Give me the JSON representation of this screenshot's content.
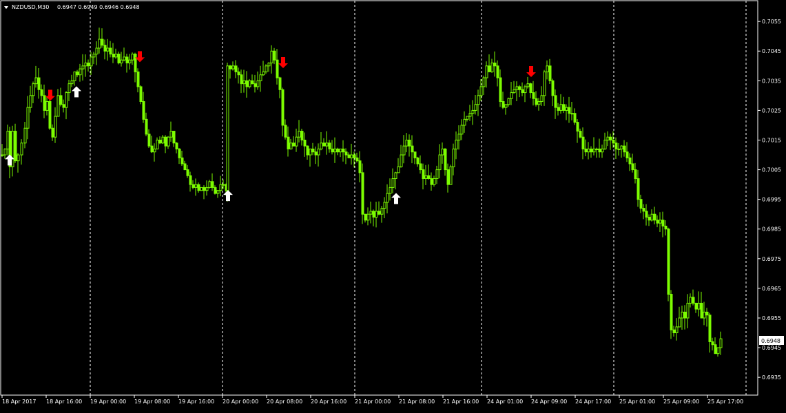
{
  "header": {
    "title": "NZDUSD,M30",
    "ohlc": "0.6947 0.6949 0.6946 0.6948",
    "menu_icon": "triangle-down-icon"
  },
  "colors": {
    "background": "#000000",
    "candle": "#7CFC00",
    "grid": "#ffffff",
    "text": "#ffffff",
    "arrow_down": "#ff0000",
    "arrow_up": "#ffffff",
    "price_label_bg": "#ffffff",
    "price_label_text": "#000000"
  },
  "chart_data": {
    "type": "candlestick",
    "symbol": "NZDUSD",
    "timeframe": "M30",
    "current_price": "0.6948",
    "ylim": [
      0.6929,
      0.7062
    ],
    "y_ticks": [
      "0.7055",
      "0.7045",
      "0.7035",
      "0.7025",
      "0.7015",
      "0.7005",
      "0.6995",
      "0.6985",
      "0.6975",
      "0.6965",
      "0.6955",
      "0.6945",
      "0.6935"
    ],
    "x_ticks": [
      "18 Apr 2017",
      "18 Apr 16:00",
      "19 Apr 00:00",
      "19 Apr 08:00",
      "19 Apr 16:00",
      "20 Apr 00:00",
      "20 Apr 08:00",
      "20 Apr 16:00",
      "21 Apr 00:00",
      "21 Apr 08:00",
      "21 Apr 16:00",
      "24 Apr 01:00",
      "24 Apr 09:00",
      "24 Apr 17:00",
      "25 Apr 01:00",
      "25 Apr 09:00",
      "25 Apr 17:00"
    ],
    "day_separators": [
      "19 Apr 00:00",
      "20 Apr 00:00",
      "21 Apr 00:00",
      "24 Apr 01:00",
      "25 Apr 01:00",
      "26 Apr"
    ],
    "close_path": [
      [
        0,
        0.701
      ],
      [
        4,
        0.7012
      ],
      [
        8,
        0.7018
      ],
      [
        11,
        0.7006
      ],
      [
        15,
        0.7018
      ],
      [
        19,
        0.7008
      ],
      [
        23,
        0.701
      ],
      [
        28,
        0.7014
      ],
      [
        33,
        0.7019
      ],
      [
        37,
        0.7026
      ],
      [
        41,
        0.703
      ],
      [
        45,
        0.7034
      ],
      [
        49,
        0.7036
      ],
      [
        53,
        0.7032
      ],
      [
        57,
        0.703
      ],
      [
        61,
        0.7025
      ],
      [
        65,
        0.7028
      ],
      [
        69,
        0.7019
      ],
      [
        73,
        0.7016
      ],
      [
        77,
        0.7023
      ],
      [
        81,
        0.703
      ],
      [
        85,
        0.7027
      ],
      [
        89,
        0.7026
      ],
      [
        93,
        0.7031
      ],
      [
        97,
        0.7034
      ],
      [
        101,
        0.7035
      ],
      [
        105,
        0.7038
      ],
      [
        109,
        0.7037
      ],
      [
        113,
        0.7039
      ],
      [
        117,
        0.704
      ],
      [
        121,
        0.7041
      ],
      [
        125,
        0.704
      ],
      [
        129,
        0.7043
      ],
      [
        133,
        0.7044
      ],
      [
        137,
        0.7046
      ],
      [
        141,
        0.7049
      ],
      [
        145,
        0.7047
      ],
      [
        149,
        0.7045
      ],
      [
        153,
        0.7046
      ],
      [
        157,
        0.7044
      ],
      [
        161,
        0.7043
      ],
      [
        165,
        0.7044
      ],
      [
        169,
        0.7041
      ],
      [
        173,
        0.7042
      ],
      [
        177,
        0.7043
      ],
      [
        181,
        0.7041
      ],
      [
        185,
        0.7042
      ],
      [
        189,
        0.7044
      ],
      [
        193,
        0.7038
      ],
      [
        197,
        0.7033
      ],
      [
        201,
        0.7028
      ],
      [
        205,
        0.7022
      ],
      [
        209,
        0.7017
      ],
      [
        213,
        0.7013
      ],
      [
        217,
        0.7011
      ],
      [
        221,
        0.7012
      ],
      [
        225,
        0.7015
      ],
      [
        229,
        0.7014
      ],
      [
        233,
        0.7016
      ],
      [
        237,
        0.7013
      ],
      [
        241,
        0.7016
      ],
      [
        245,
        0.7018
      ],
      [
        249,
        0.7014
      ],
      [
        253,
        0.7012
      ],
      [
        257,
        0.7009
      ],
      [
        261,
        0.7007
      ],
      [
        265,
        0.7005
      ],
      [
        269,
        0.7003
      ],
      [
        273,
        0.7
      ],
      [
        277,
        0.6999
      ],
      [
        281,
        0.7
      ],
      [
        285,
        0.6998
      ],
      [
        289,
        0.6999
      ],
      [
        293,
        0.6998
      ],
      [
        297,
        0.6999
      ],
      [
        301,
        0.7001
      ],
      [
        305,
        0.6999
      ],
      [
        309,
        0.6997
      ],
      [
        313,
        0.6998
      ],
      [
        317,
        0.7
      ],
      [
        321,
        0.7
      ],
      [
        325,
        0.6998
      ],
      [
        327,
        0.704
      ],
      [
        331,
        0.7039
      ],
      [
        335,
        0.704
      ],
      [
        339,
        0.7038
      ],
      [
        343,
        0.7037
      ],
      [
        347,
        0.7034
      ],
      [
        351,
        0.7035
      ],
      [
        355,
        0.7033
      ],
      [
        359,
        0.7035
      ],
      [
        363,
        0.7034
      ],
      [
        367,
        0.7033
      ],
      [
        371,
        0.7035
      ],
      [
        375,
        0.7037
      ],
      [
        379,
        0.7038
      ],
      [
        383,
        0.704
      ],
      [
        387,
        0.7041
      ],
      [
        391,
        0.7045
      ],
      [
        395,
        0.7042
      ],
      [
        399,
        0.7036
      ],
      [
        403,
        0.7032
      ],
      [
        407,
        0.702
      ],
      [
        411,
        0.7016
      ],
      [
        415,
        0.7012
      ],
      [
        419,
        0.7014
      ],
      [
        423,
        0.7013
      ],
      [
        427,
        0.7016
      ],
      [
        431,
        0.7018
      ],
      [
        435,
        0.7015
      ],
      [
        439,
        0.7013
      ],
      [
        443,
        0.701
      ],
      [
        447,
        0.7012
      ],
      [
        451,
        0.7011
      ],
      [
        455,
        0.701
      ],
      [
        459,
        0.7012
      ],
      [
        463,
        0.7014
      ],
      [
        467,
        0.7013
      ],
      [
        471,
        0.7014
      ],
      [
        475,
        0.7012
      ],
      [
        479,
        0.7011
      ],
      [
        483,
        0.7012
      ],
      [
        487,
        0.7011
      ],
      [
        491,
        0.7012
      ],
      [
        495,
        0.7011
      ],
      [
        499,
        0.701
      ],
      [
        503,
        0.7009
      ],
      [
        507,
        0.701
      ],
      [
        511,
        0.7009
      ],
      [
        515,
        0.7008
      ],
      [
        519,
        0.7004
      ],
      [
        523,
        0.699
      ],
      [
        527,
        0.6988
      ],
      [
        531,
        0.699
      ],
      [
        535,
        0.6991
      ],
      [
        539,
        0.6989
      ],
      [
        543,
        0.6991
      ],
      [
        547,
        0.699
      ],
      [
        551,
        0.6992
      ],
      [
        555,
        0.6994
      ],
      [
        559,
        0.6997
      ],
      [
        563,
        0.6999
      ],
      [
        567,
        0.7002
      ],
      [
        571,
        0.7004
      ],
      [
        575,
        0.7006
      ],
      [
        579,
        0.701
      ],
      [
        583,
        0.7013
      ],
      [
        587,
        0.7015
      ],
      [
        591,
        0.7013
      ],
      [
        595,
        0.7011
      ],
      [
        599,
        0.7009
      ],
      [
        603,
        0.7007
      ],
      [
        607,
        0.7005
      ],
      [
        611,
        0.7002
      ],
      [
        615,
        0.7003
      ],
      [
        619,
        0.7002
      ],
      [
        623,
        0.7
      ],
      [
        627,
        0.7002
      ],
      [
        631,
        0.7005
      ],
      [
        635,
        0.701
      ],
      [
        639,
        0.7012
      ],
      [
        643,
        0.7005
      ],
      [
        647,
        0.7
      ],
      [
        651,
        0.7006
      ],
      [
        655,
        0.7012
      ],
      [
        659,
        0.7015
      ],
      [
        663,
        0.7017
      ],
      [
        667,
        0.702
      ],
      [
        671,
        0.7022
      ],
      [
        675,
        0.7023
      ],
      [
        679,
        0.7024
      ],
      [
        683,
        0.7025
      ],
      [
        687,
        0.7027
      ],
      [
        691,
        0.703
      ],
      [
        695,
        0.7033
      ],
      [
        699,
        0.7036
      ],
      [
        703,
        0.704
      ],
      [
        707,
        0.7038
      ],
      [
        711,
        0.7041
      ],
      [
        715,
        0.704
      ],
      [
        719,
        0.7036
      ],
      [
        723,
        0.7028
      ],
      [
        727,
        0.7026
      ],
      [
        731,
        0.7027
      ],
      [
        735,
        0.7029
      ],
      [
        739,
        0.7031
      ],
      [
        743,
        0.7032
      ],
      [
        747,
        0.7033
      ],
      [
        751,
        0.7032
      ],
      [
        755,
        0.7031
      ],
      [
        759,
        0.7033
      ],
      [
        763,
        0.7034
      ],
      [
        767,
        0.7031
      ],
      [
        771,
        0.7029
      ],
      [
        775,
        0.7027
      ],
      [
        779,
        0.7028
      ],
      [
        783,
        0.703
      ],
      [
        787,
        0.7038
      ],
      [
        791,
        0.704
      ],
      [
        795,
        0.7035
      ],
      [
        799,
        0.703
      ],
      [
        803,
        0.7026
      ],
      [
        807,
        0.7025
      ],
      [
        811,
        0.7027
      ],
      [
        815,
        0.7025
      ],
      [
        819,
        0.7026
      ],
      [
        823,
        0.7024
      ],
      [
        827,
        0.7024
      ],
      [
        831,
        0.7021
      ],
      [
        835,
        0.7018
      ],
      [
        839,
        0.7016
      ],
      [
        843,
        0.7012
      ],
      [
        847,
        0.7011
      ],
      [
        851,
        0.7012
      ],
      [
        855,
        0.7011
      ],
      [
        859,
        0.7012
      ],
      [
        863,
        0.7012
      ],
      [
        867,
        0.7011
      ],
      [
        871,
        0.7012
      ],
      [
        875,
        0.7015
      ],
      [
        879,
        0.7016
      ],
      [
        883,
        0.7015
      ],
      [
        887,
        0.7014
      ],
      [
        891,
        0.7012
      ],
      [
        895,
        0.7012
      ],
      [
        899,
        0.7013
      ],
      [
        903,
        0.7011
      ],
      [
        907,
        0.7009
      ],
      [
        911,
        0.7007
      ],
      [
        915,
        0.7005
      ],
      [
        919,
        0.7002
      ],
      [
        923,
        0.6995
      ],
      [
        927,
        0.6992
      ],
      [
        931,
        0.6991
      ],
      [
        935,
        0.6989
      ],
      [
        939,
        0.6988
      ],
      [
        943,
        0.699
      ],
      [
        947,
        0.6988
      ],
      [
        951,
        0.6987
      ],
      [
        955,
        0.6988
      ],
      [
        959,
        0.6986
      ],
      [
        963,
        0.6985
      ],
      [
        967,
        0.6963
      ],
      [
        971,
        0.6951
      ],
      [
        975,
        0.695
      ],
      [
        979,
        0.6952
      ],
      [
        983,
        0.6955
      ],
      [
        987,
        0.6957
      ],
      [
        991,
        0.6955
      ],
      [
        995,
        0.696
      ],
      [
        999,
        0.6962
      ],
      [
        1003,
        0.696
      ],
      [
        1007,
        0.6958
      ],
      [
        1011,
        0.696
      ],
      [
        1015,
        0.6955
      ],
      [
        1019,
        0.6957
      ],
      [
        1023,
        0.6956
      ],
      [
        1027,
        0.6947
      ],
      [
        1031,
        0.6946
      ],
      [
        1035,
        0.6943
      ],
      [
        1039,
        0.6945
      ],
      [
        1043,
        0.6948
      ]
    ],
    "signals": [
      {
        "type": "up",
        "x": 4
      },
      {
        "type": "down",
        "x": 63
      },
      {
        "type": "up",
        "x": 101
      },
      {
        "type": "down",
        "x": 193
      },
      {
        "type": "up",
        "x": 321
      },
      {
        "type": "down",
        "x": 401
      },
      {
        "type": "up",
        "x": 565
      },
      {
        "type": "down",
        "x": 761
      }
    ]
  }
}
